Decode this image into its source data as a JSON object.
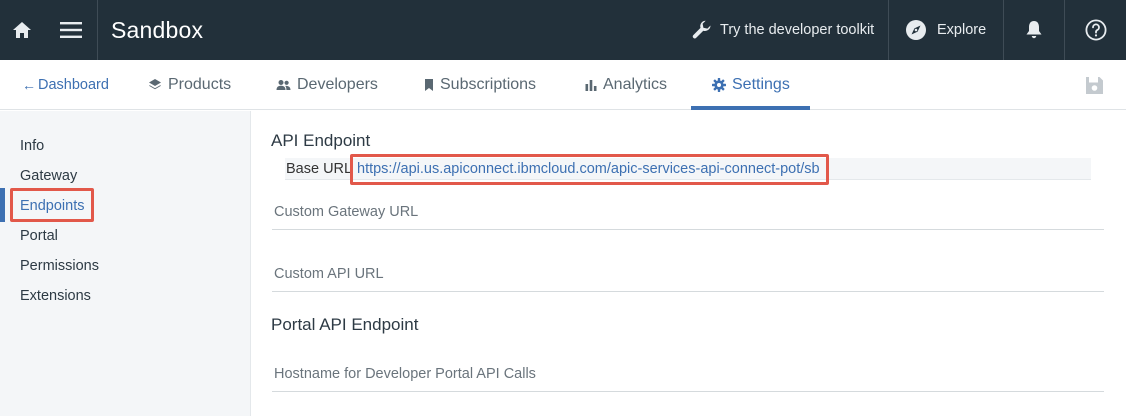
{
  "header": {
    "title": "Sandbox",
    "toolkit_label": "Try the developer toolkit",
    "explore_label": "Explore",
    "icons": [
      "home-icon",
      "menu-icon",
      "wrench-icon",
      "compass-icon",
      "bell-icon",
      "help-icon"
    ]
  },
  "tabs": {
    "back_label": "Dashboard",
    "items": [
      {
        "label": "Products",
        "icon": "layers-icon"
      },
      {
        "label": "Developers",
        "icon": "people-icon"
      },
      {
        "label": "Subscriptions",
        "icon": "bookmark-icon"
      },
      {
        "label": "Analytics",
        "icon": "bar-chart-icon"
      },
      {
        "label": "Settings",
        "icon": "gear-icon",
        "active": true
      }
    ]
  },
  "sidebar": {
    "items": [
      {
        "label": "Info"
      },
      {
        "label": "Gateway"
      },
      {
        "label": "Endpoints",
        "active": true
      },
      {
        "label": "Portal"
      },
      {
        "label": "Permissions"
      },
      {
        "label": "Extensions"
      }
    ]
  },
  "main": {
    "api_endpoint_heading": "API Endpoint",
    "base_url_label": "Base URL",
    "base_url_value": "https://api.us.apiconnect.ibmcloud.com/apic-services-api-connect-pot/sb",
    "custom_gateway_url_placeholder": "Custom Gateway URL",
    "custom_api_url_placeholder": "Custom API URL",
    "portal_api_endpoint_heading": "Portal API Endpoint",
    "hostname_placeholder": "Hostname for Developer Portal API Calls"
  },
  "colors": {
    "header_bg": "#22303a",
    "accent": "#3d70b2",
    "highlight": "#e2584a",
    "sidebar_bg": "#f4f6f8"
  }
}
